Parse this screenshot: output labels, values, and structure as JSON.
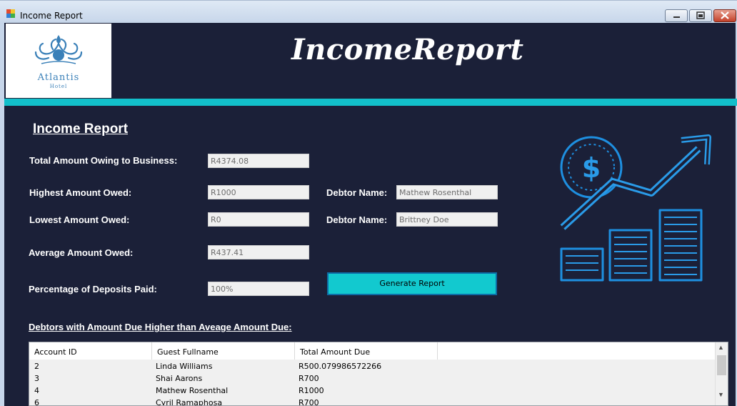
{
  "window": {
    "title": "Income Report"
  },
  "header": {
    "title": "IncomeReport",
    "logo_name": "Atlantis",
    "logo_sub": "Hotel"
  },
  "form": {
    "section_title": "Income Report",
    "total_owing_label": "Total Amount Owing to Business:",
    "total_owing_value": "R4374.08",
    "highest_label": "Highest Amount Owed:",
    "highest_value": "R1000",
    "highest_debtor_label": "Debtor Name:",
    "highest_debtor_value": "Mathew Rosenthal",
    "lowest_label": "Lowest Amount Owed:",
    "lowest_value": "R0",
    "lowest_debtor_label": "Debtor Name:",
    "lowest_debtor_value": "Brittney Doe",
    "average_label": "Average Amount Owed:",
    "average_value": "R437.41",
    "percentage_label": "Percentage of Deposits Paid:",
    "percentage_value": "100%",
    "generate_button": "Generate Report"
  },
  "table": {
    "title": "Debtors with Amount Due Higher than Aveage Amount Due:",
    "columns": [
      "Account ID",
      "Guest Fullname",
      "Total Amount Due"
    ],
    "rows": [
      [
        "2",
        "Linda Williams",
        "R500.079986572266"
      ],
      [
        "3",
        "Shai Aarons",
        "R700"
      ],
      [
        "4",
        "Mathew Rosenthal",
        "R1000"
      ],
      [
        "6",
        "Cyril Ramaphosa",
        "R700"
      ]
    ]
  },
  "colors": {
    "background": "#1b2038",
    "accent": "#12bfca",
    "icon_blue": "#1e8fe0"
  },
  "icons": [
    "app-icon",
    "minimize-icon",
    "maximize-icon",
    "close-icon",
    "hotel-logo-icon",
    "income-growth-icon",
    "scroll-up-icon",
    "scroll-down-icon"
  ]
}
